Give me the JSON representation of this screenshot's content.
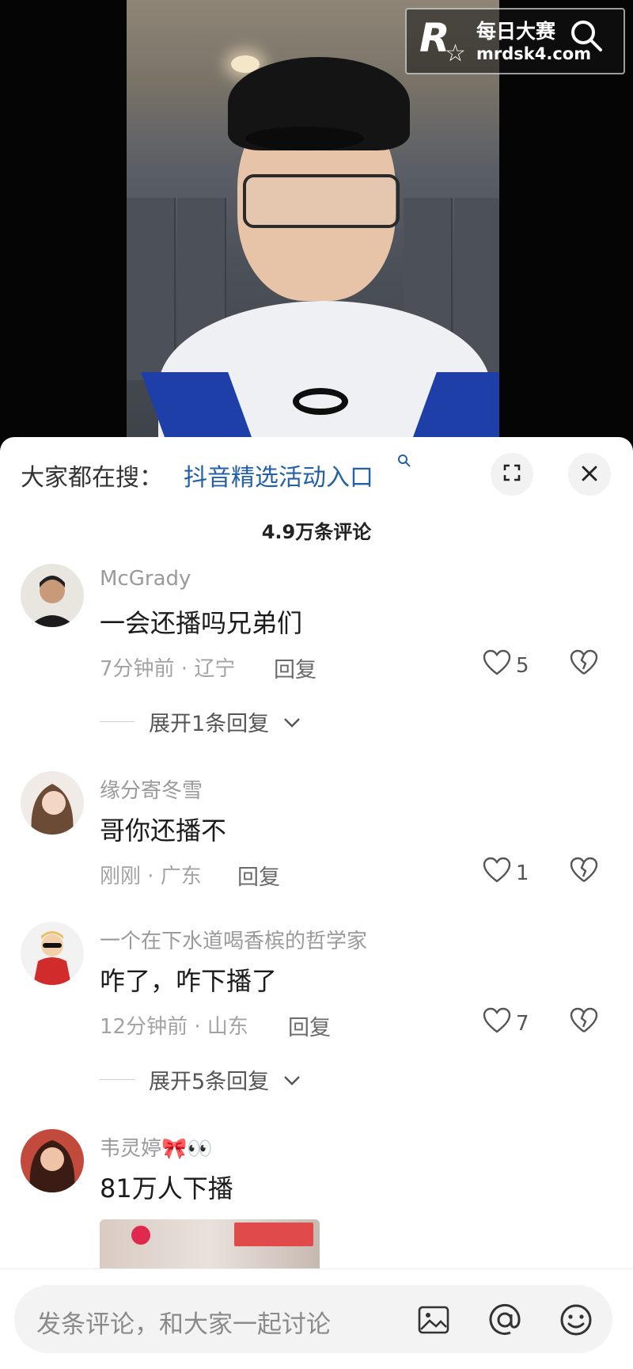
{
  "watermark": {
    "top_text": "每日大赛",
    "bottom_text": "mrdsk4.com"
  },
  "search_bar": {
    "prefix": "大家都在搜：",
    "link": "抖音精选活动入口"
  },
  "comments_header": {
    "count_label": "4.9万条评论"
  },
  "comments": [
    {
      "username": "McGrady",
      "text": "一会还播吗兄弟们",
      "meta": "7分钟前 · 辽宁",
      "reply_label": "回复",
      "likes": "5",
      "expand_label": "展开1条回复"
    },
    {
      "username": "缘分寄冬雪",
      "text": "哥你还播不",
      "meta": "刚刚 · 广东",
      "reply_label": "回复",
      "likes": "1"
    },
    {
      "username": "一个在下水道喝香槟的哲学家",
      "text": "咋了，咋下播了",
      "meta": "12分钟前 · 山东",
      "reply_label": "回复",
      "likes": "7",
      "expand_label": "展开5条回复"
    },
    {
      "username": "韦灵婷",
      "username_decor": "🎀👀",
      "text": "81万人下播"
    }
  ],
  "composer": {
    "placeholder": "发条评论，和大家一起讨论"
  },
  "icons": {
    "search": "search-icon",
    "expand": "expand-icon",
    "close": "close-icon",
    "heart": "heart-icon",
    "broken_heart": "broken-heart-icon",
    "image": "image-icon",
    "mention": "at-icon",
    "emoji": "emoji-icon"
  },
  "colors": {
    "link": "#2460a8",
    "meta": "#a3a3a3",
    "text": "#1b1b1b"
  }
}
